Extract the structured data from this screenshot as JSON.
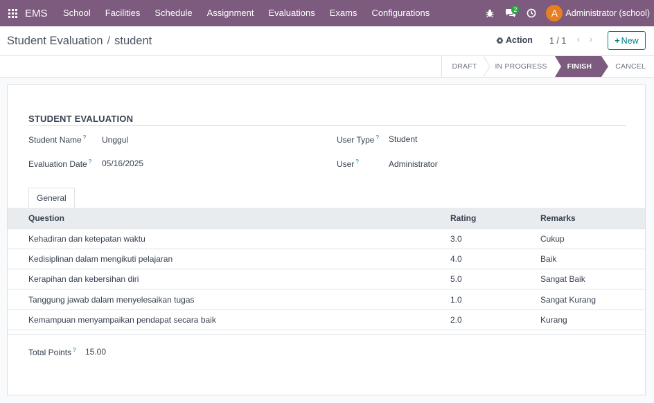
{
  "navbar": {
    "brand": "EMS",
    "menu": [
      "School",
      "Facilities",
      "Schedule",
      "Assignment",
      "Evaluations",
      "Exams",
      "Configurations"
    ],
    "messages_count": "2",
    "avatar_letter": "A",
    "user": "Administrator (school)"
  },
  "control": {
    "breadcrumb_parent": "Student Evaluation",
    "breadcrumb_current": "student",
    "action_label": "Action",
    "pager": "1 / 1",
    "new_label": "New"
  },
  "stages": [
    "DRAFT",
    "IN PROGRESS",
    "FINISH",
    "CANCEL"
  ],
  "active_stage": "FINISH",
  "form": {
    "section_title": "STUDENT EVALUATION",
    "fields": {
      "student_name_label": "Student Name",
      "student_name": "Unggul",
      "evaluation_date_label": "Evaluation Date",
      "evaluation_date": "05/16/2025",
      "user_type_label": "User Type",
      "user_type": "Student",
      "user_label": "User",
      "user": "Administrator"
    },
    "tab_label": "General",
    "table": {
      "headers": [
        "Question",
        "Rating",
        "Remarks"
      ],
      "rows": [
        [
          "Kehadiran dan ketepatan waktu",
          "3.0",
          "Cukup"
        ],
        [
          "Kedisiplinan dalam mengikuti pelajaran",
          "4.0",
          "Baik"
        ],
        [
          "Kerapihan dan kebersihan diri",
          "5.0",
          "Sangat Baik"
        ],
        [
          "Tanggung jawab dalam menyelesaikan tugas",
          "1.0",
          "Sangat Kurang"
        ],
        [
          "Kemampuan menyampaikan pendapat secara baik",
          "2.0",
          "Kurang"
        ]
      ]
    },
    "total_points_label": "Total Points",
    "total_points": "15.00",
    "help_mark": "?"
  },
  "colors": {
    "brand": "#7c5b7e",
    "accent": "#017e84",
    "badge": "#28a745",
    "avatar": "#e67e22"
  }
}
